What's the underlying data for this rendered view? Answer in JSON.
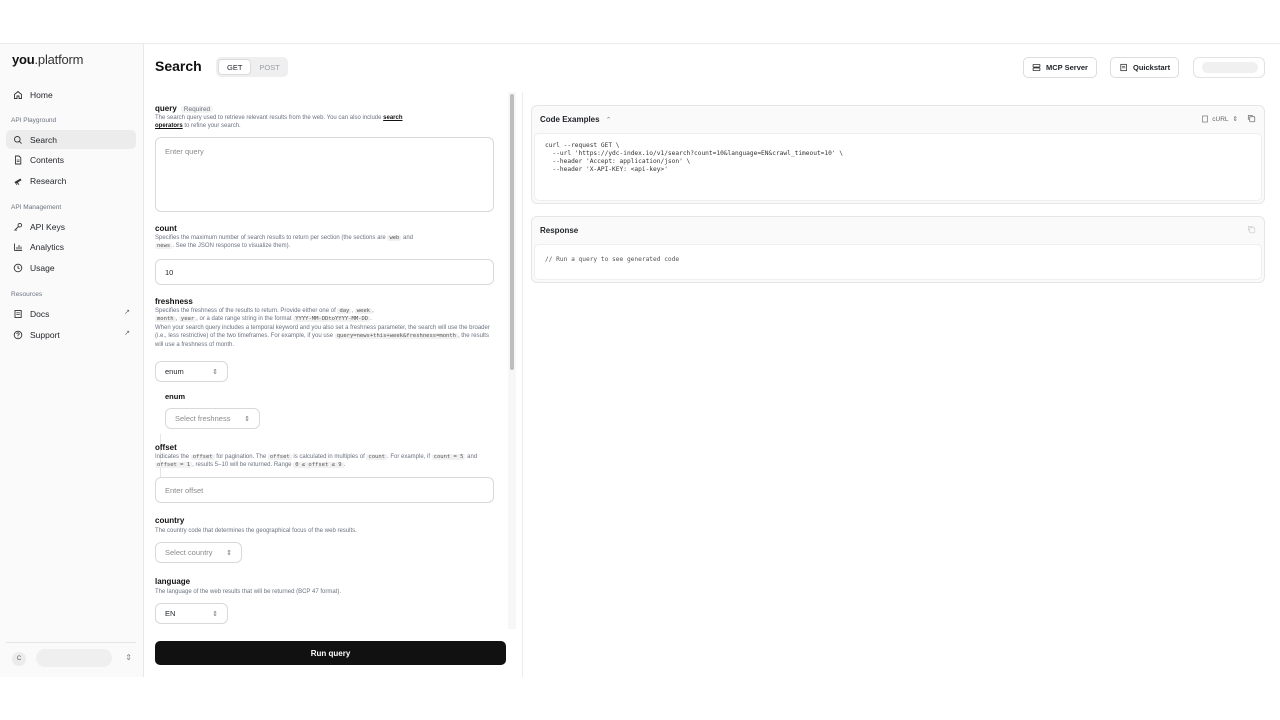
{
  "sidebar": {
    "logo_bold": "you",
    "logo_rest": ".platform",
    "home": "Home",
    "section_playground": "API Playground",
    "search": "Search",
    "contents": "Contents",
    "research": "Research",
    "section_management": "API Management",
    "api_keys": "API Keys",
    "analytics": "Analytics",
    "usage": "Usage",
    "section_resources": "Resources",
    "docs": "Docs",
    "support": "Support",
    "ext_arrow": "↗",
    "user_initial": "C"
  },
  "header": {
    "title": "Search",
    "method_get": "GET",
    "method_post": "POST",
    "mcp_server": "MCP Server",
    "quickstart": "Quickstart"
  },
  "form": {
    "query": {
      "label": "query",
      "required": "Required",
      "desc_before": "The search query used to retrieve relevant results from the web. You can also include ",
      "desc_link1": "search",
      "desc_link2": "operators",
      "desc_after": " to refine your search.",
      "placeholder": "Enter query"
    },
    "count": {
      "label": "count",
      "desc_1": "Specifies the maximum number of search results to return per section (the sections are ",
      "code_web": "web",
      "desc_2": " and",
      "code_news": "news",
      "desc_3": ". See the JSON response to visualize them).",
      "value": "10"
    },
    "freshness": {
      "label": "freshness",
      "d1": "Specifies the freshness of the results to return. Provide either one of ",
      "c_day": "day",
      "c_week": "week",
      "c_month": "month",
      "c_year": "year",
      "d2": ", or a date range string in the format ",
      "c_range": "YYYY-MM-DDtoYYYY-MM-DD",
      "d3": "When your search query includes a temporal keyword and you also set a freshness parameter, the search will use the broader (i.e., less restrictive) of the two timeframes. For example, if you use ",
      "c_example": "query=news+this+week&freshness=month",
      "d4": ", the results will use a freshness of month.",
      "type_value": "enum",
      "sub_label": "enum",
      "sub_placeholder": "Select freshness"
    },
    "offset": {
      "label": "offset",
      "d1": "Indicates the ",
      "c_offset": "offset",
      "d2": " for pagination. The ",
      "d3": " is calculated in multiples of ",
      "c_count": "count",
      "d4": ". For example, if ",
      "c_count5": "count = 5",
      "d5": " and ",
      "c_offset1": "offset = 1",
      "d6": ", results 5–10 will be returned. Range ",
      "c_range": "0 ≤ offset ≤ 9",
      "placeholder": "Enter offset"
    },
    "country": {
      "label": "country",
      "desc": "The country code that determines the geographical focus of the web results.",
      "placeholder": "Select country"
    },
    "language": {
      "label": "language",
      "desc": "The language of the web results that will be returned (BCP 47 format).",
      "value": "EN"
    },
    "run_button": "Run query"
  },
  "code_examples": {
    "title": "Code Examples",
    "language": "cURL",
    "code": "curl --request GET \\\n  --url 'https://ydc-index.io/v1/search?count=10&language=EN&crawl_timeout=10' \\\n  --header 'Accept: application/json' \\\n  --header 'X-API-KEY: <api-key>'"
  },
  "response": {
    "title": "Response",
    "placeholder": "// Run a query to see generated code"
  }
}
